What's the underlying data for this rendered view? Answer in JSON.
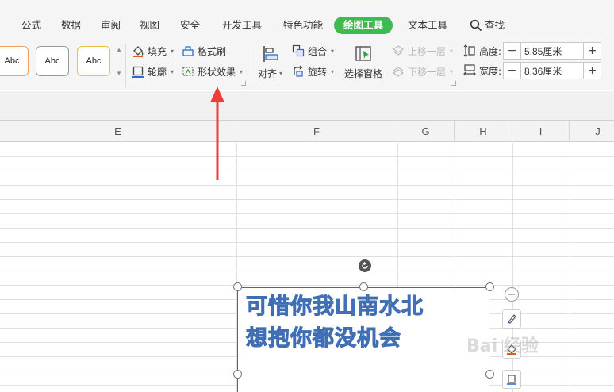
{
  "menu": {
    "tabs": [
      {
        "label": "公式"
      },
      {
        "label": "数据"
      },
      {
        "label": "审阅"
      },
      {
        "label": "视图"
      },
      {
        "label": "安全"
      },
      {
        "label": "开发工具"
      },
      {
        "label": "特色功能"
      },
      {
        "label": "绘图工具",
        "active": true
      },
      {
        "label": "文本工具"
      }
    ],
    "search_label": "查找",
    "active_color": "#3fb950"
  },
  "ribbon": {
    "styles": [
      "Abc",
      "Abc",
      "Abc"
    ],
    "format_group": {
      "fill": "填充",
      "outline": "轮廓",
      "format_painter": "格式刷",
      "shape_effects": "形状效果"
    },
    "arrange_group": {
      "align": "对齐",
      "group": "组合",
      "rotate": "旋转",
      "selection_pane": "选择窗格",
      "bring_forward": "上移一层",
      "send_backward": "下移一层"
    },
    "size_group": {
      "height_label": "高度:",
      "height_value": "5.85厘米",
      "width_label": "宽度:",
      "width_value": "8.36厘米"
    }
  },
  "sheet": {
    "columns": [
      "E",
      "F",
      "G",
      "H",
      "I",
      "J"
    ]
  },
  "shape": {
    "lines": [
      "可惜你我山南水北",
      "想抱你都没机会"
    ]
  },
  "watermark": "Bai 经验",
  "annotation_color": "#ee3b3b"
}
